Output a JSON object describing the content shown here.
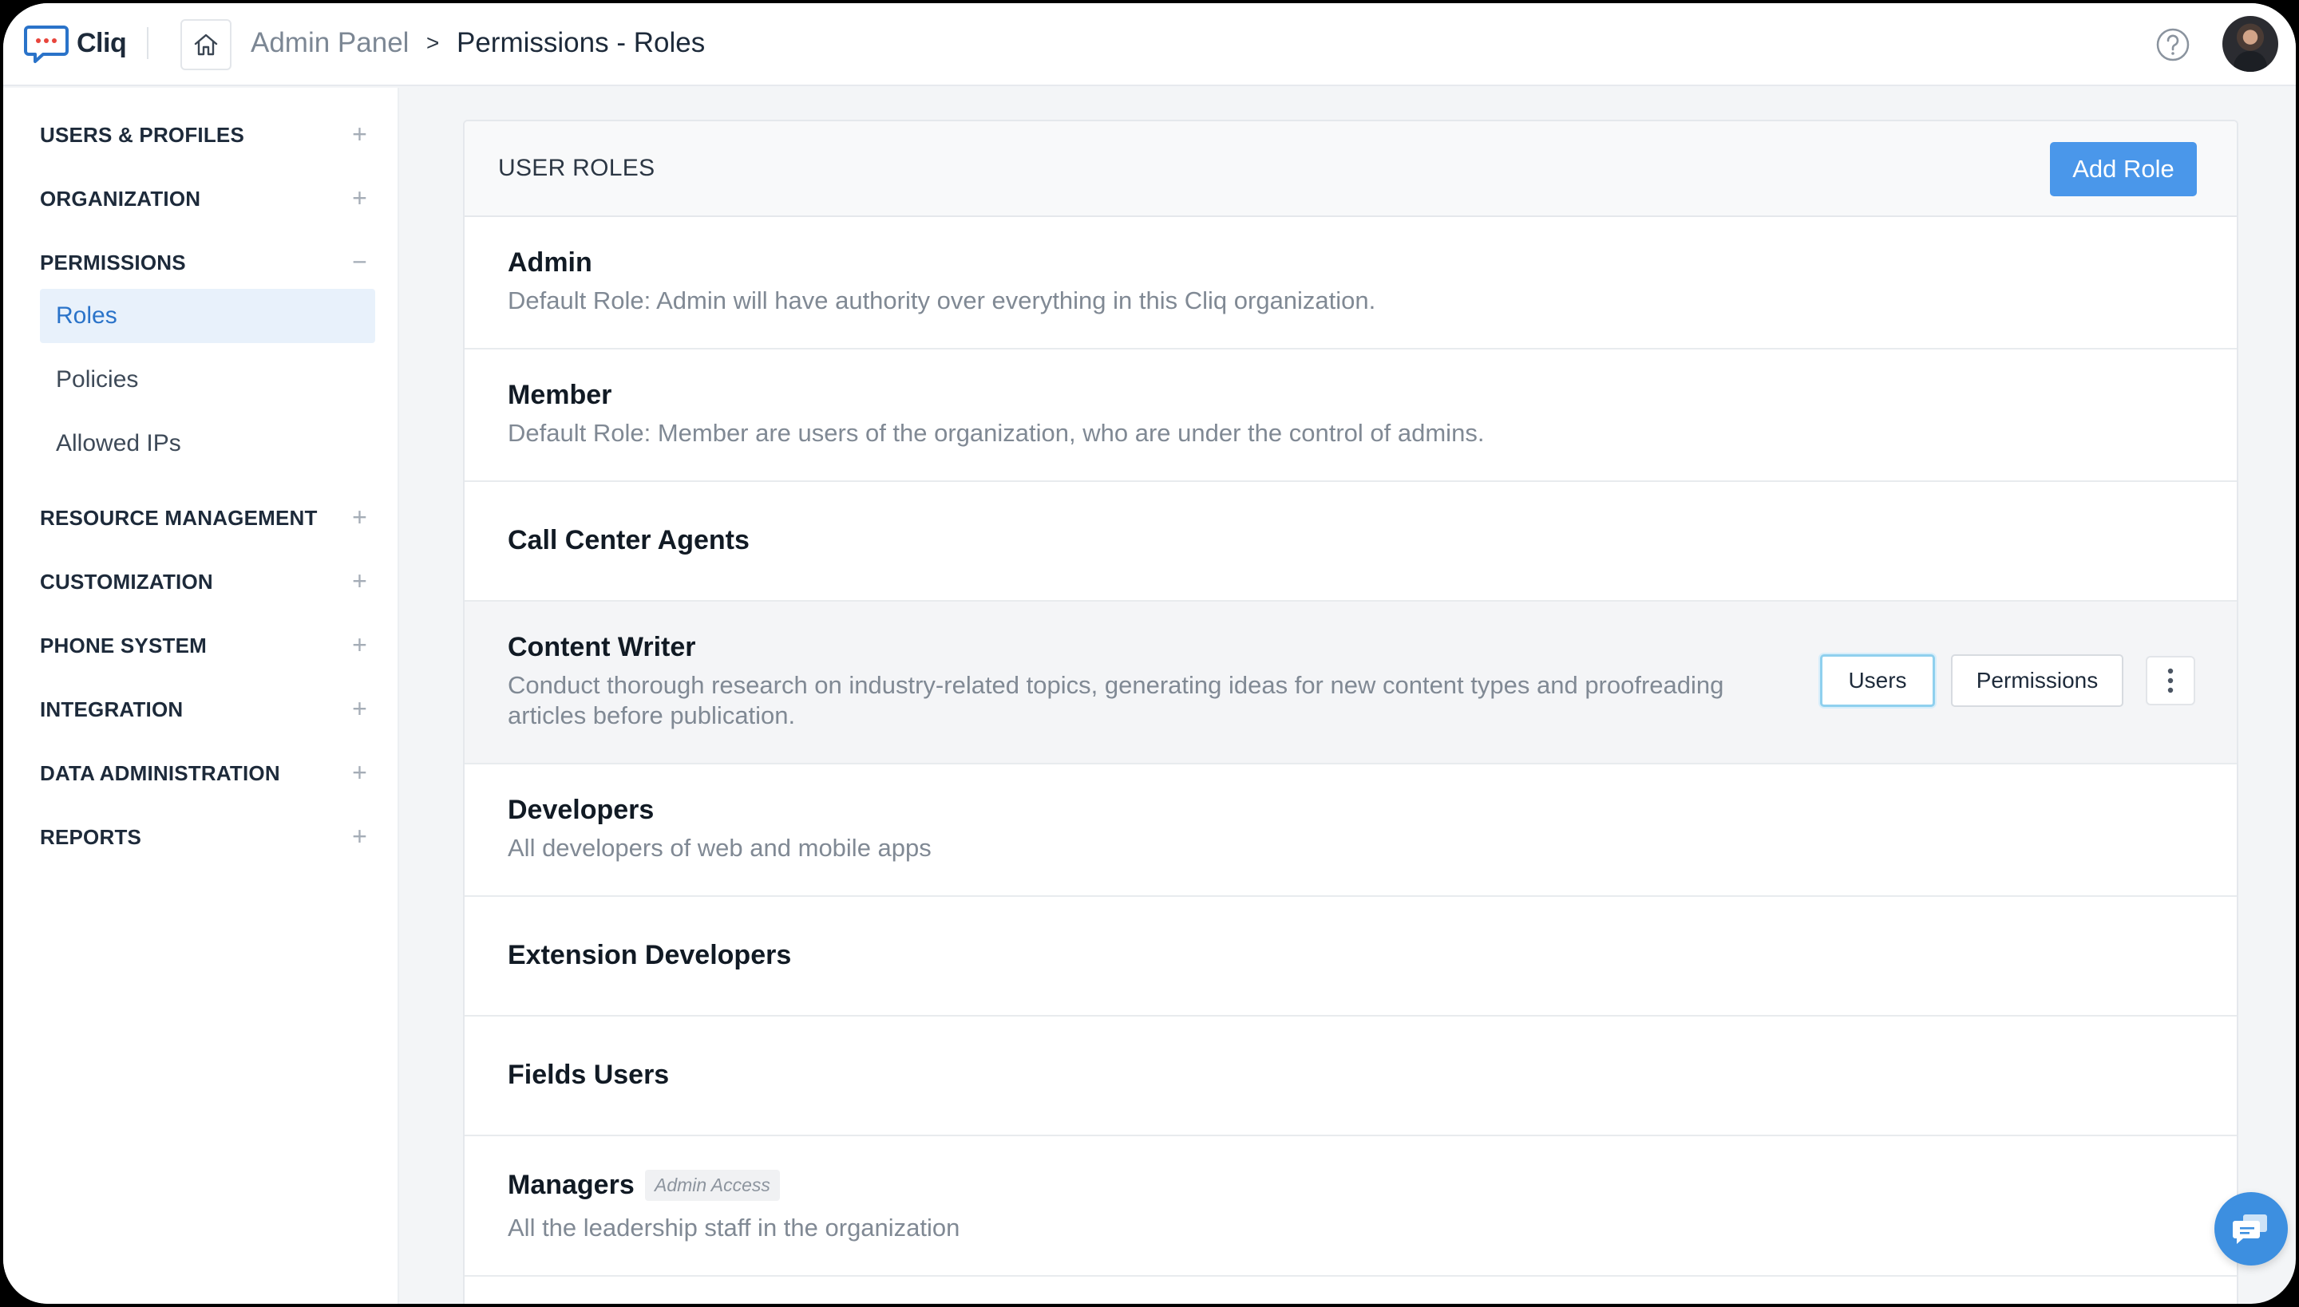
{
  "app": {
    "name": "Cliq"
  },
  "breadcrumb": {
    "root": "Admin Panel",
    "separator": ">",
    "current": "Permissions - Roles"
  },
  "sidebar": {
    "sections": [
      {
        "label": "USERS & PROFILES",
        "toggle": "+"
      },
      {
        "label": "ORGANIZATION",
        "toggle": "+"
      },
      {
        "label": "PERMISSIONS",
        "toggle": "−"
      },
      {
        "label": "RESOURCE MANAGEMENT",
        "toggle": "+"
      },
      {
        "label": "CUSTOMIZATION",
        "toggle": "+"
      },
      {
        "label": "PHONE SYSTEM",
        "toggle": "+"
      },
      {
        "label": "INTEGRATION",
        "toggle": "+"
      },
      {
        "label": "DATA ADMINISTRATION",
        "toggle": "+"
      },
      {
        "label": "REPORTS",
        "toggle": "+"
      }
    ],
    "permissions_items": [
      {
        "label": "Roles",
        "active": true
      },
      {
        "label": "Policies"
      },
      {
        "label": "Allowed IPs"
      }
    ]
  },
  "panel": {
    "title": "USER ROLES",
    "add_button": "Add Role",
    "roles": [
      {
        "name": "Admin",
        "description": "Default Role: Admin will have authority over everything in this Cliq organization."
      },
      {
        "name": "Member",
        "description": "Default Role: Member are users of the organization, who are under the control of admins."
      },
      {
        "name": "Call Center Agents",
        "description": ""
      },
      {
        "name": "Content Writer",
        "description": "Conduct thorough research on industry-related topics, generating ideas for new content types and proofreading articles before publication."
      },
      {
        "name": "Developers",
        "description": "All developers of web and mobile apps"
      },
      {
        "name": "Extension Developers",
        "description": ""
      },
      {
        "name": "Fields Users",
        "description": ""
      },
      {
        "name": "Managers",
        "description": "All the leadership staff in the organization",
        "badge": "Admin Access"
      }
    ],
    "row_actions": {
      "users": "Users",
      "permissions": "Permissions"
    }
  },
  "colors": {
    "accent": "#4a97ea",
    "active_nav_bg": "#e8f1fb",
    "active_nav_text": "#2a73c9",
    "logo_red": "#e8453c"
  },
  "icons": [
    "cliq-logo-icon",
    "home-icon",
    "help-icon",
    "avatar",
    "kebab-menu-icon",
    "chat-icon"
  ]
}
